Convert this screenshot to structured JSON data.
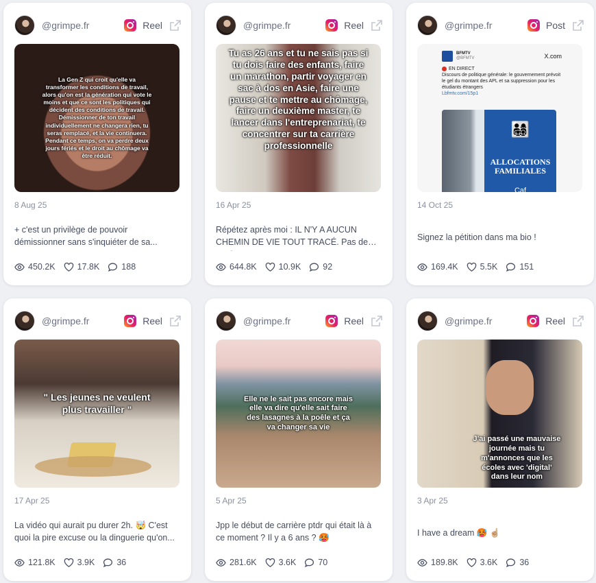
{
  "posts": [
    {
      "handle": "@grimpe.fr",
      "type": "Reel",
      "thumb_text": "La Gen Z qui croit qu'elle va transformer les conditions de travail, alors qu'on est la génération qui vote le moins et que ce sont les politiques qui décident des conditions de travail. Démissionner de ton travail individuellement ne changera rien, tu seras remplacé, et la vie continuera. Pendant ce temps, on va perdre deux jours fériés et le droit au chômage va être réduit.",
      "date": "8 Aug 25",
      "caption": "+ c'est un privilège de pouvoir démissionner sans s'inquiéter de sa...",
      "views": "450.2K",
      "likes": "17.8K",
      "comments": "188"
    },
    {
      "handle": "@grimpe.fr",
      "type": "Reel",
      "thumb_text": "Tu as 26 ans et tu ne sais pas si tu dois faire des enfants, faire un marathon, partir voyager en sac à dos en Asie, faire une pause et te mettre au chômage, faire un deuxième master, te lancer dans l'entreprenariat, te concentrer sur ta carrière professionnelle",
      "date": "16 Apr 25",
      "caption": "Répétez après moi : IL N'Y A AUCUN CHEMIN DE VIE TOUT TRACÉ. Pas de mod...",
      "views": "644.8K",
      "likes": "10.9K",
      "comments": "92"
    },
    {
      "handle": "@grimpe.fr",
      "type": "Post",
      "tweet": {
        "account": "BFMTV",
        "account_handle": "@BFMTV",
        "site": "X.com",
        "live": "EN DIRECT",
        "text": "Discours de politique générale: le gouvernement prévoit le gel du montant des APL et sa suppression pour les étudiants étrangers",
        "link": "Lbfmtv.com/15p1",
        "sign_text": "ALLOCATIONS FAMILIALES",
        "sign_sub": "Caf"
      },
      "date": "14 Oct 25",
      "caption": "Signez la pétition dans ma bio !",
      "views": "169.4K",
      "likes": "5.5K",
      "comments": "151"
    },
    {
      "handle": "@grimpe.fr",
      "type": "Reel",
      "thumb_text": "\" Les jeunes ne veulent plus travailler \"",
      "date": "17 Apr 25",
      "caption": "La vidéo qui aurait pu durer 2h. 🤯 C'est quoi la pire excuse ou la dinguerie qu'on...",
      "views": "121.8K",
      "likes": "3.9K",
      "comments": "36"
    },
    {
      "handle": "@grimpe.fr",
      "type": "Reel",
      "thumb_text": "Elle ne le sait pas encore mais elle va dire qu'elle sait faire des lasagnes à la poêle et ça va changer sa vie",
      "date": "5 Apr 25",
      "caption": "Jpp le début de carrière ptdr qui était là à ce moment ? Il y a 6 ans ? 🥵",
      "views": "281.6K",
      "likes": "3.6K",
      "comments": "70"
    },
    {
      "handle": "@grimpe.fr",
      "type": "Reel",
      "thumb_text": "J'ai passé une mauvaise journée mais tu m'annonces que les écoles avec 'digital' dans leur nom",
      "date": "3 Apr 25",
      "caption": "I have a dream 🥵 ☝🏼",
      "views": "189.8K",
      "likes": "3.6K",
      "comments": "36"
    }
  ],
  "colors": {
    "page_bg": "#eef0f4",
    "card_bg": "#ffffff",
    "muted_text": "#8a90a0",
    "instagram_gradient": [
      "#f9a825",
      "#e91e63",
      "#9c27b0"
    ]
  }
}
